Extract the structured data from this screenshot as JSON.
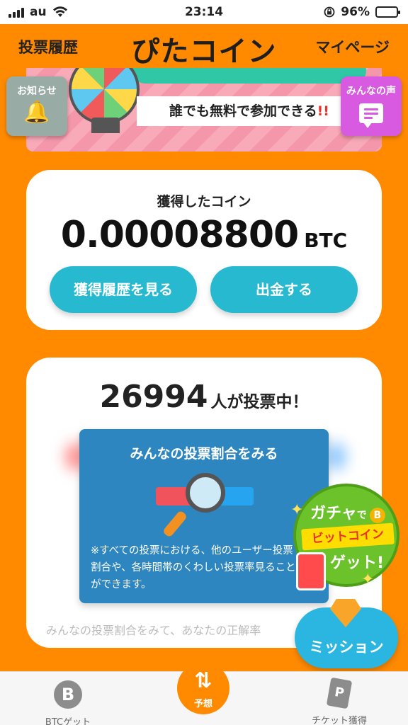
{
  "status_bar": {
    "carrier": "au",
    "time": "23:14",
    "battery": "96%",
    "battery_level": 0.96
  },
  "header": {
    "left_link": "投票履歴",
    "logo": "ぴたコイン",
    "right_link": "マイページ"
  },
  "banner": {
    "text": "誰でも無料で参加できる",
    "emphasis": "!!"
  },
  "side_buttons": {
    "news": "お知らせ",
    "voice": "みんなの声"
  },
  "coin_card": {
    "label": "獲得したコイン",
    "value": "0.00008800",
    "unit": "BTC",
    "history_button": "獲得履歴を見る",
    "withdraw_button": "出金する"
  },
  "vote_card": {
    "count": "26994",
    "count_suffix": "人が投票中！",
    "footer": "みんなの投票割合をみて、あなたの正解率"
  },
  "vote_modal": {
    "title": "みんなの投票割合をみる",
    "description": "※すべての投票における、他のユーザー投票割合や、各時間帯のくわしい投票率見ることができます。"
  },
  "gacha_promo": {
    "line1_a": "ガチャ",
    "line1_b": "で",
    "line2": "ビットコイン",
    "line3": "ゲット!"
  },
  "mission": {
    "label": "ミッション"
  },
  "bottom_nav": {
    "btc": "BTCゲット",
    "predict": "予想",
    "ticket": "チケット獲得"
  },
  "colors": {
    "brand_orange": "#ff8a00",
    "accent_teal": "#26b9cf",
    "modal_blue": "#2e86c0",
    "promo_green": "#6cc22a"
  },
  "icons": [
    "wifi-icon",
    "lock-rotation-icon",
    "battery-icon",
    "bell-icon",
    "chat-icon",
    "magnifier-icon",
    "bitcoin-icon",
    "swap-arrows-icon",
    "ticket-icon",
    "gem-icon"
  ]
}
